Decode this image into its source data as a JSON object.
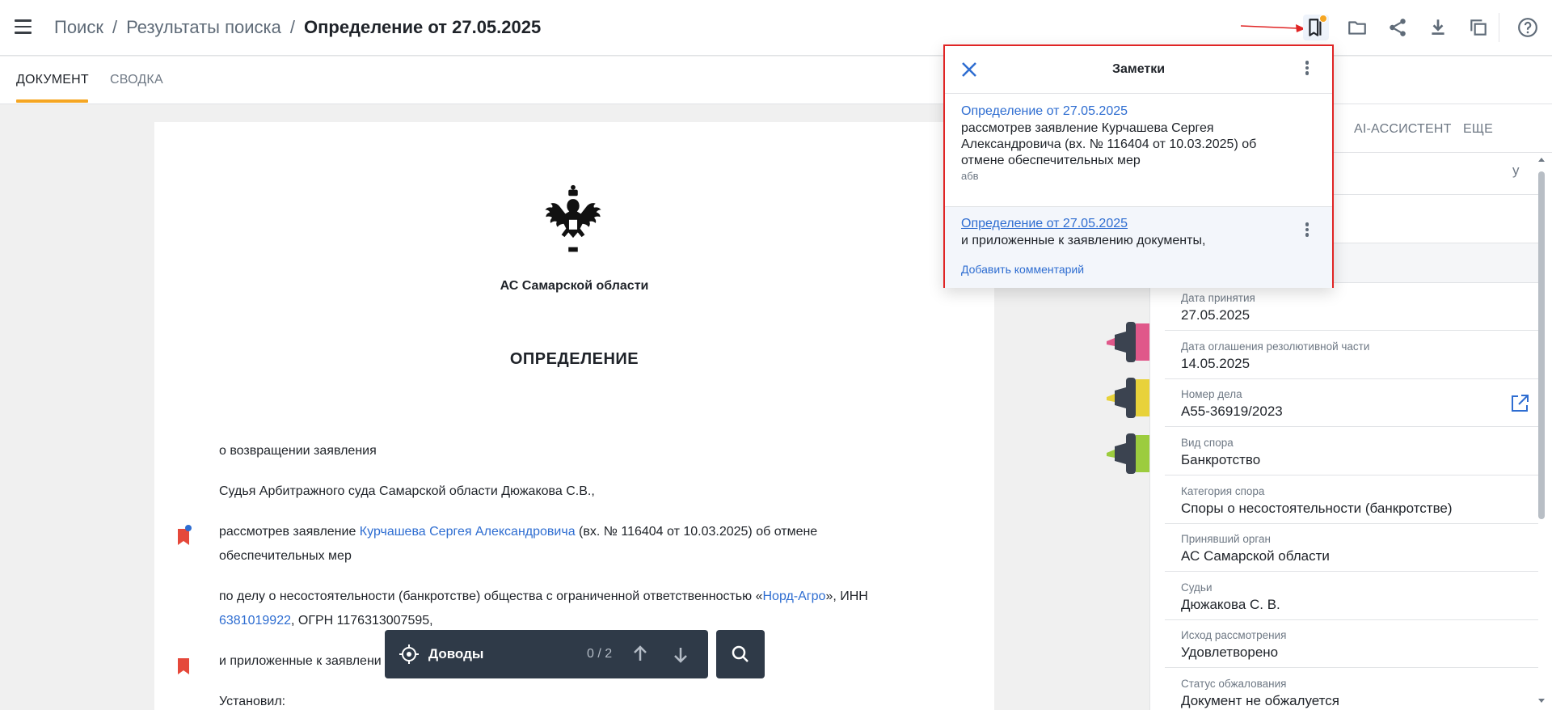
{
  "header": {
    "breadcrumb": [
      "Поиск",
      "Результаты поиска",
      "Определение от 27.05.2025"
    ],
    "separator": "/"
  },
  "tabs": [
    {
      "label": "ДОКУМЕНТ",
      "active": true
    },
    {
      "label": "СВОДКА",
      "active": false
    }
  ],
  "document": {
    "court": "АС Самарской области",
    "title": "ОПРЕДЕЛЕНИЕ",
    "p1": "о возвращении заявления",
    "p2": "Судья Арбитражного суда Самарской области Дюжакова С.В.,",
    "p3_a": "рассмотрев заявление ",
    "p3_link": "Курчашева Сергея Александровича",
    "p3_b": " (вх. № 116404 от 10.03.2025) об отмене",
    "p3_c": "обеспечительных мер",
    "p4_a": "по делу о несостоятельности (банкротстве) общества с ограниченной ответственностью «",
    "p4_link1": "Норд-Агро",
    "p4_b": "», ИНН",
    "p4_link2": "6381019922",
    "p4_c": ", ОГРН 1176313007595,",
    "p5": "и приложенные к заявлени",
    "p6": "Установил:"
  },
  "args_bar": {
    "label": "Доводы",
    "count": "0 / 2"
  },
  "right_panel": {
    "tabs": [
      "AI-АССИСТЕНТ",
      "ЕЩЕ"
    ],
    "partial_top": "у",
    "rows": [
      {
        "label": "Дата принятия",
        "value": "27.05.2025"
      },
      {
        "label": "Дата оглашения резолютивной части",
        "value": "14.05.2025"
      },
      {
        "label": "Номер дела",
        "value": "А55-36919/2023"
      },
      {
        "label": "Вид спора",
        "value": "Банкротство"
      },
      {
        "label": "Категория спора",
        "value": "Споры о несостоятельности (банкротстве)"
      },
      {
        "label": "Принявший орган",
        "value": "АС Самарской области"
      },
      {
        "label": "Судьи",
        "value": "Дюжакова С. В."
      },
      {
        "label": "Исход рассмотрения",
        "value": "Удовлетворено"
      },
      {
        "label": "Статус обжалования",
        "value": "Документ не обжалуется"
      }
    ]
  },
  "notes": {
    "title": "Заметки",
    "items": [
      {
        "link": "Определение от 27.05.2025",
        "text": "рассмотрев заявление Курчашева Сергея Александровича (вх. № 116404 от 10.03.2025) об отмене обеспечительных мер",
        "author": "абв"
      },
      {
        "link": "Определение от 27.05.2025",
        "text": "и приложенные к заявлению документы,",
        "action": "Добавить комментарий"
      }
    ]
  },
  "colors": {
    "accent": "#f5a623",
    "link": "#2e6dd1",
    "bookmark": "#e5483a",
    "dark_bar": "#2f3a48",
    "highlight_border": "#e02424",
    "marker_pink": "#e0588a",
    "marker_yellow": "#e8d23a",
    "marker_green": "#9ccc3e"
  }
}
